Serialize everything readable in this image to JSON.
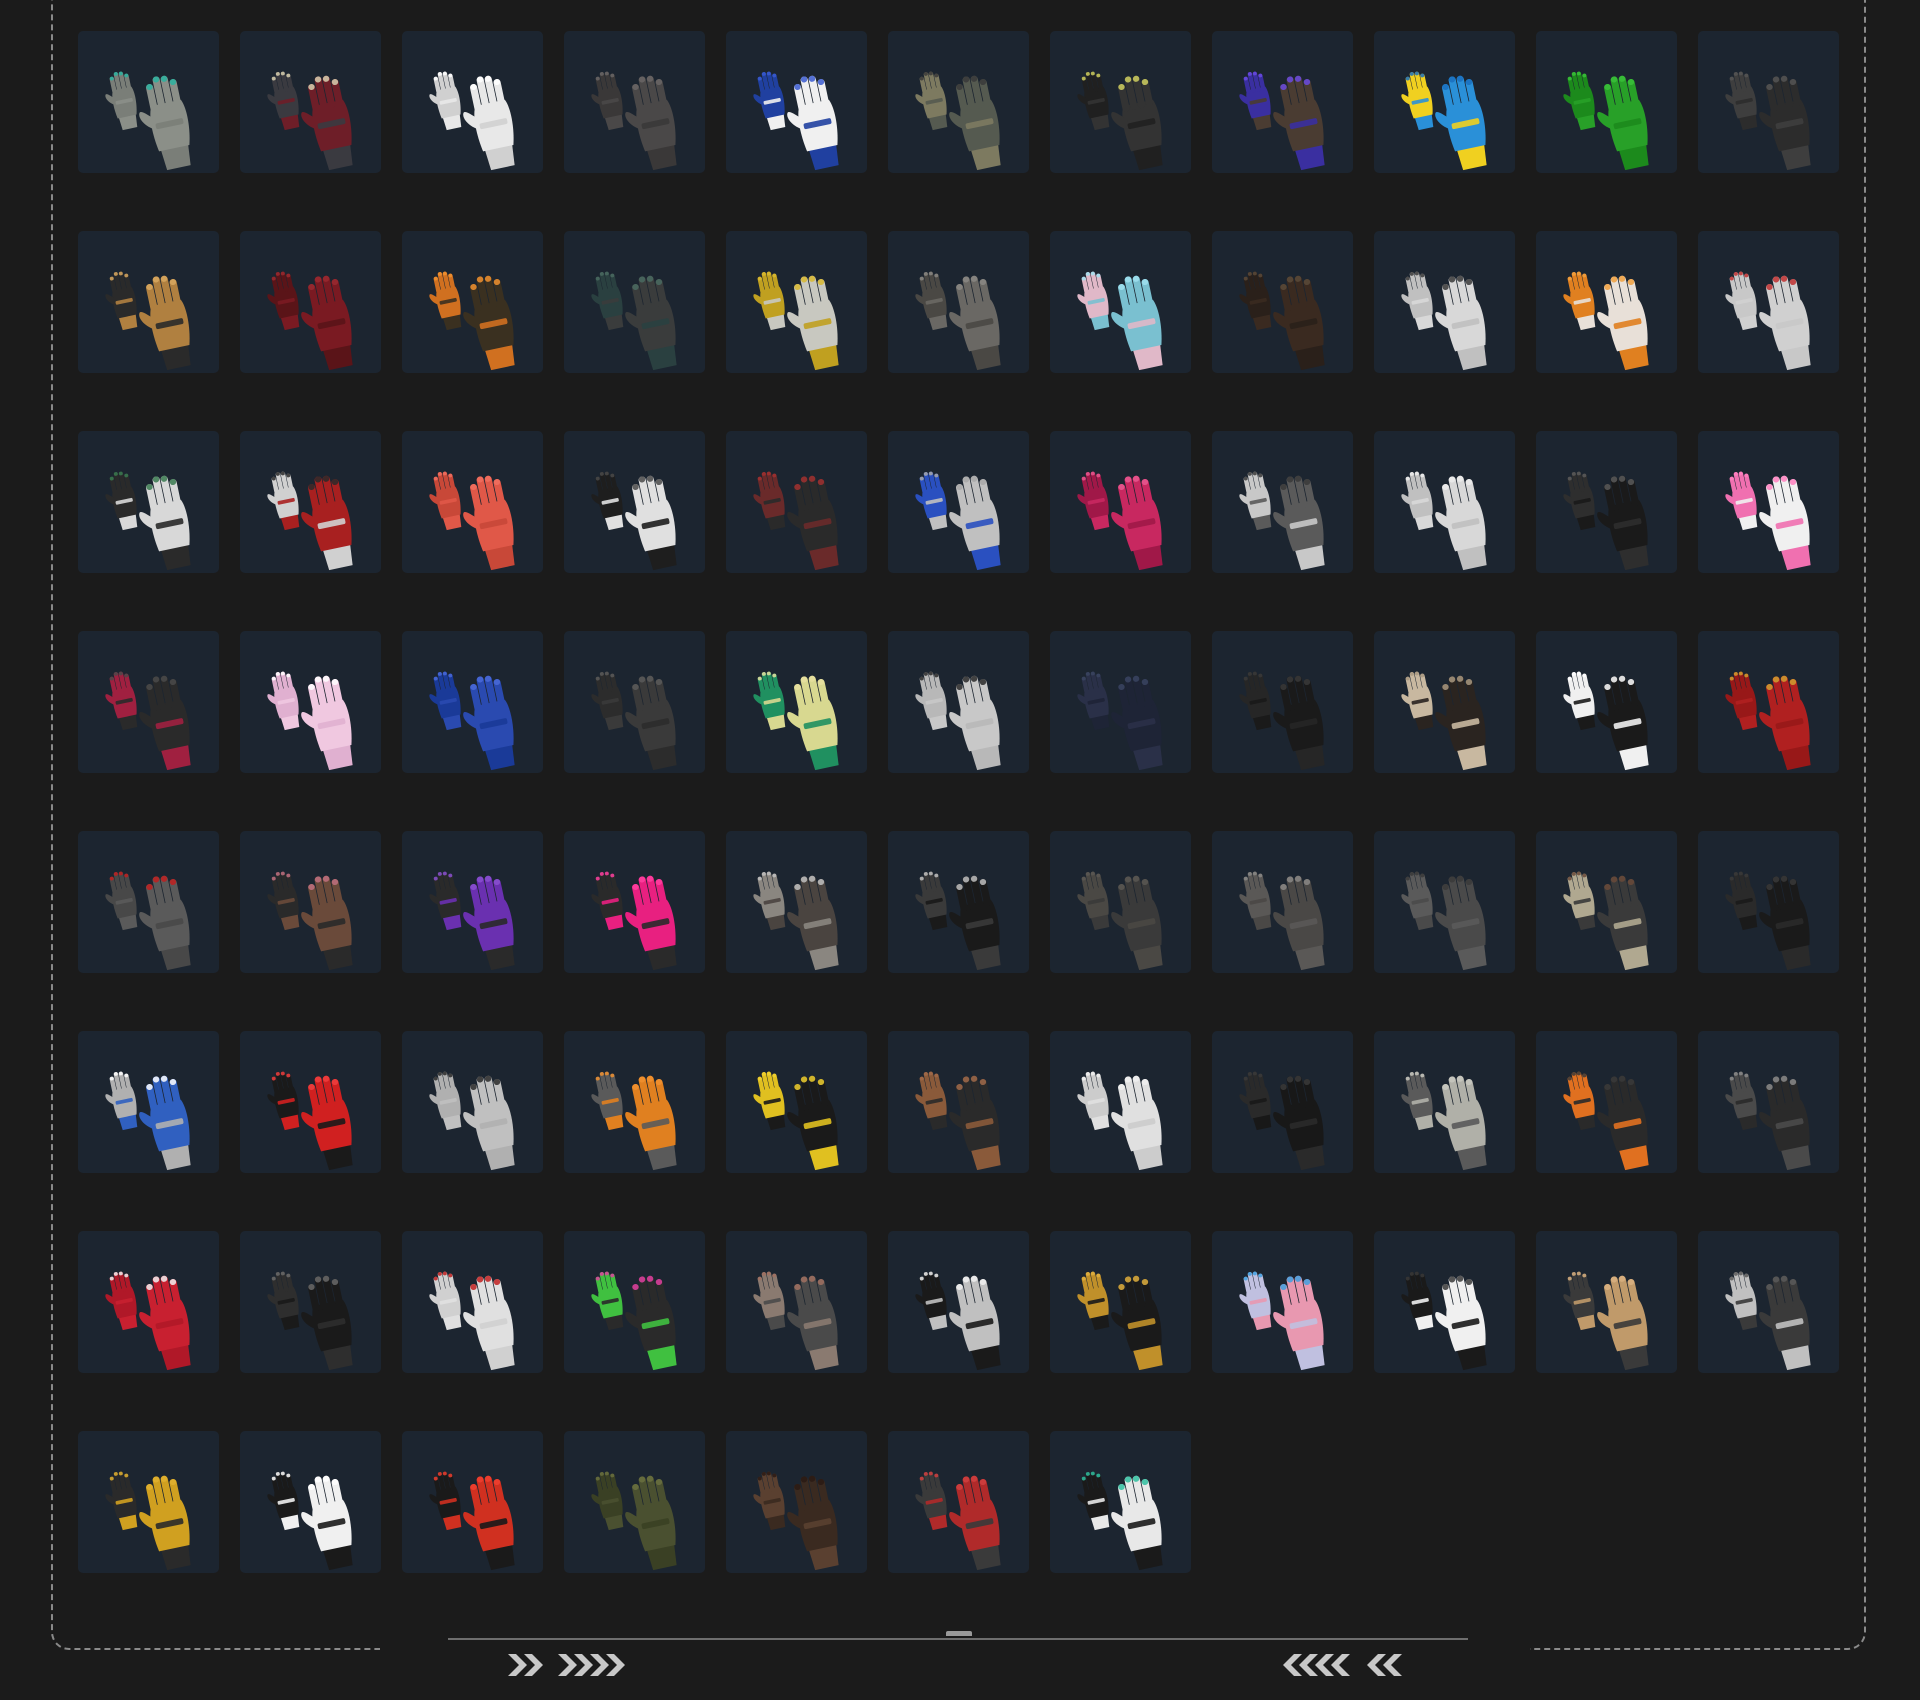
{
  "colors": {
    "background": "#1b1b1b",
    "slot": "#1c2530",
    "frame": "#8a8a8a"
  },
  "footer": {
    "left_chevrons": "forward-chevrons-icon",
    "right_chevrons": "backward-chevrons-icon"
  },
  "inventory": {
    "columns": 11,
    "slots": [
      {
        "icon": "gray-hand-ring-icon",
        "c1": "#8b8f88",
        "c2": "#7a7e78",
        "accent": "#2ab3a0"
      },
      {
        "icon": "red-mech-glove-icon",
        "c1": "#6e1e28",
        "c2": "#3a3a40",
        "accent": "#d8d0b0"
      },
      {
        "icon": "white-fingerless-glove-icon",
        "c1": "#e8e8e8",
        "c2": "#d0d0d0",
        "accent": "#ffffff"
      },
      {
        "icon": "dark-leather-fingerless-icon",
        "c1": "#4a4848",
        "c2": "#3a3838",
        "accent": "#6a6666"
      },
      {
        "icon": "blue-white-glove-icon",
        "c1": "#f0f0f0",
        "c2": "#2040a0",
        "accent": "#3a5ad0"
      },
      {
        "icon": "camo-fingerless-glove-icon",
        "c1": "#555a50",
        "c2": "#7d7a60",
        "accent": "#3a3a3a"
      },
      {
        "icon": "nail-accessories-icon",
        "c1": "#333333",
        "c2": "#202020",
        "accent": "#cfcf60"
      },
      {
        "icon": "purple-claw-glove-icon",
        "c1": "#4a3c32",
        "c2": "#3a2fa0",
        "accent": "#6a4ae0"
      },
      {
        "icon": "blue-yellow-glove-icon",
        "c1": "#2a90d8",
        "c2": "#f0d020",
        "accent": "#1a70c0"
      },
      {
        "icon": "green-glove-icon",
        "c1": "#28a028",
        "c2": "#1c8a1c",
        "accent": "#3ac03a"
      },
      {
        "icon": "black-leather-glove-icon",
        "c1": "#2c2c2c",
        "c2": "#3e3e3e",
        "accent": "#555555"
      },
      {
        "icon": "gold-armor-glove-icon",
        "c1": "#b08040",
        "c2": "#2a2a2a",
        "accent": "#d8a860"
      },
      {
        "icon": "maroon-glove-icon",
        "c1": "#7a1a22",
        "c2": "#5a1418",
        "accent": "#9a2a30"
      },
      {
        "icon": "orange-tactical-glove-icon",
        "c1": "#3a3020",
        "c2": "#d07020",
        "accent": "#f09030"
      },
      {
        "icon": "dark-teal-fingerless-icon",
        "c1": "#3a3c3c",
        "c2": "#2a4040",
        "accent": "#4a6a60"
      },
      {
        "icon": "yellow-gray-work-glove-icon",
        "c1": "#c8c8c0",
        "c2": "#c0a020",
        "accent": "#d8b830"
      },
      {
        "icon": "gray-wrapped-glove-icon",
        "c1": "#6a6864",
        "c2": "#4a4844",
        "accent": "#8a8884"
      },
      {
        "icon": "cyan-spiked-glove-icon",
        "c1": "#7ac0d0",
        "c2": "#e0b8c8",
        "accent": "#a0e0f0"
      },
      {
        "icon": "brown-knuckle-glove-icon",
        "c1": "#3a2a20",
        "c2": "#2a201a",
        "accent": "#5a4a3a"
      },
      {
        "icon": "white-knuckle-glove-icon",
        "c1": "#d8d8d8",
        "c2": "#c0c0c0",
        "accent": "#3a3a3a"
      },
      {
        "icon": "orange-white-glove-icon",
        "c1": "#e8e0d8",
        "c2": "#e08020",
        "accent": "#f0a040"
      },
      {
        "icon": "white-hand-red-nails-icon",
        "c1": "#d0d0d0",
        "c2": "#c8c8c8",
        "accent": "#c03030"
      },
      {
        "icon": "white-black-tactical-glove-icon",
        "c1": "#d8d8d8",
        "c2": "#2a2a2a",
        "accent": "#3a7a50"
      },
      {
        "icon": "red-moto-glove-icon",
        "c1": "#a82020",
        "c2": "#d0d0d0",
        "accent": "#2a2a2a"
      },
      {
        "icon": "coral-glove-icon",
        "c1": "#e05848",
        "c2": "#c84838",
        "accent": "#f07060"
      },
      {
        "icon": "black-white-moto-glove-icon",
        "c1": "#e0e0e0",
        "c2": "#1e1e1e",
        "accent": "#4a4a4a"
      },
      {
        "icon": "black-red-stitched-glove-icon",
        "c1": "#2a2a2a",
        "c2": "#6a2a2a",
        "accent": "#a03030"
      },
      {
        "icon": "gray-blue-knit-glove-icon",
        "c1": "#c0c0c0",
        "c2": "#2a50c0",
        "accent": "#a8a8a8"
      },
      {
        "icon": "pink-fingerless-glove-icon",
        "c1": "#c82860",
        "c2": "#a01848",
        "accent": "#e85890"
      },
      {
        "icon": "gray-armored-glove-icon",
        "c1": "#5a5a5a",
        "c2": "#c8c8c8",
        "accent": "#3a3a3a"
      },
      {
        "icon": "white-hand-icon",
        "c1": "#d8d8d8",
        "c2": "#c0c0c0",
        "accent": "#ececec"
      },
      {
        "icon": "black-buckle-glove-icon",
        "c1": "#1a1a1a",
        "c2": "#2e2e2e",
        "accent": "#5a5a5a"
      },
      {
        "icon": "white-pink-glove-icon",
        "c1": "#f0f0f0",
        "c2": "#f070b0",
        "accent": "#ff80c0"
      },
      {
        "icon": "black-red-tactical-glove-icon",
        "c1": "#2a2a2a",
        "c2": "#a02040",
        "accent": "#4a4a4a"
      },
      {
        "icon": "light-pink-glove-icon",
        "c1": "#f0c8e0",
        "c2": "#e0b0d0",
        "accent": "#ffffff"
      },
      {
        "icon": "blue-glove-icon",
        "c1": "#2a4ab0",
        "c2": "#1a3a98",
        "accent": "#4a6ad8"
      },
      {
        "icon": "dark-gray-glove-icon",
        "c1": "#3a3a3a",
        "c2": "#2c2c2c",
        "accent": "#5a5a5a"
      },
      {
        "icon": "yellow-green-knit-glove-icon",
        "c1": "#d8d890",
        "c2": "#209060",
        "accent": "#e8e0a0"
      },
      {
        "icon": "white-hand-bracelet-icon",
        "c1": "#c8c8c8",
        "c2": "#b8b8b8",
        "accent": "#2a2a2a"
      },
      {
        "icon": "navy-glove-icon",
        "c1": "#1e2436",
        "c2": "#2a3048",
        "accent": "#3a4460"
      },
      {
        "icon": "black-long-glove-icon",
        "c1": "#1a1a1a",
        "c2": "#262626",
        "accent": "#3a3a3a"
      },
      {
        "icon": "skeleton-glove-icon",
        "c1": "#2a2420",
        "c2": "#c8b8a0",
        "accent": "#a89880"
      },
      {
        "icon": "black-white-sport-glove-icon",
        "c1": "#1a1a1a",
        "c2": "#f0f0f0",
        "accent": "#ffffff"
      },
      {
        "icon": "red-gold-glove-icon",
        "c1": "#b02020",
        "c2": "#981818",
        "accent": "#d0a030"
      },
      {
        "icon": "gray-wrist-guard-icon",
        "c1": "#5a5a5a",
        "c2": "#484848",
        "accent": "#c02020"
      },
      {
        "icon": "brown-arm-sleeve-icon",
        "c1": "#6a4a3a",
        "c2": "#2a2a2a",
        "accent": "#c07080"
      },
      {
        "icon": "purple-tactical-glove-icon",
        "c1": "#6a30b0",
        "c2": "#2a2a2a",
        "accent": "#8a50d0"
      },
      {
        "icon": "hot-pink-glove-icon",
        "c1": "#e82080",
        "c2": "#2a2a2a",
        "accent": "#ff40a0"
      },
      {
        "icon": "brown-strap-fingerless-icon",
        "c1": "#4a4440",
        "c2": "#8a8680",
        "accent": "#c0c0c0"
      },
      {
        "icon": "black-strap-glove-icon",
        "c1": "#1a1a1a",
        "c2": "#3a3a3a",
        "accent": "#c0c0c0"
      },
      {
        "icon": "dark-wrap-bandage-icon",
        "c1": "#3a3a3a",
        "c2": "#4a4844",
        "accent": "#5a5854"
      },
      {
        "icon": "gray-stud-bracer-icon",
        "c1": "#4a4846",
        "c2": "#5a5856",
        "accent": "#8a8886"
      },
      {
        "icon": "dark-gray-wrap-glove-icon",
        "c1": "#4a4a4a",
        "c2": "#5a5a5a",
        "accent": "#3a3a3a"
      },
      {
        "icon": "silver-knuckle-glove-icon",
        "c1": "#3a3a3a",
        "c2": "#b0a890",
        "accent": "#6a4a3a"
      },
      {
        "icon": "black-sleeve-icon",
        "c1": "#1a1a1a",
        "c2": "#2a2a2a",
        "accent": "#3a3a3a"
      },
      {
        "icon": "blue-chainmail-glove-icon",
        "c1": "#3060c0",
        "c2": "#b0b0b0",
        "accent": "#ffffff"
      },
      {
        "icon": "red-black-glove-icon",
        "c1": "#d02020",
        "c2": "#1a1a1a",
        "accent": "#f04040"
      },
      {
        "icon": "gray-hand-rings-icon",
        "c1": "#c0c0c0",
        "c2": "#b0b0b0",
        "accent": "#2a2a2a"
      },
      {
        "icon": "orange-gray-glove-icon",
        "c1": "#e08020",
        "c2": "#5a5a5a",
        "accent": "#f09030"
      },
      {
        "icon": "yellow-black-moto-glove-icon",
        "c1": "#1a1a1a",
        "c2": "#e0c020",
        "accent": "#f0d030"
      },
      {
        "icon": "claw-accessories-icon",
        "c1": "#2a2a2a",
        "c2": "#8a5a3a",
        "accent": "#a06a4a"
      },
      {
        "icon": "white-cloth-glove-icon",
        "c1": "#e0e0e0",
        "c2": "#cccccc",
        "accent": "#f0f0f0"
      },
      {
        "icon": "black-leather-tight-glove-icon",
        "c1": "#181818",
        "c2": "#2a2a2a",
        "accent": "#3a3a3a"
      },
      {
        "icon": "bandage-wrap-glove-icon",
        "c1": "#b0b0a8",
        "c2": "#5a5a5a",
        "accent": "#c8c8c0"
      },
      {
        "icon": "black-orange-tactical-glove-icon",
        "c1": "#2a2a2a",
        "c2": "#e07020",
        "accent": "#3a3a3a"
      },
      {
        "icon": "black-fingerless-spike-glove-icon",
        "c1": "#2a2a2a",
        "c2": "#4a4a4a",
        "accent": "#8a8a8a"
      },
      {
        "icon": "red-snowflake-glove-icon",
        "c1": "#c82030",
        "c2": "#b01828",
        "accent": "#f0f0f0"
      },
      {
        "icon": "black-studded-glove-icon",
        "c1": "#1a1a1a",
        "c2": "#2e2e2e",
        "accent": "#6a6a6a"
      },
      {
        "icon": "white-hand-red-tips-icon",
        "c1": "#e0e0e0",
        "c2": "#d0d0d0",
        "accent": "#c02020"
      },
      {
        "icon": "colorful-nail-set-icon",
        "c1": "#2a2a2a",
        "c2": "#40c040",
        "accent": "#e040a0"
      },
      {
        "icon": "gray-brown-glove-icon",
        "c1": "#4a4a4a",
        "c2": "#8a7a70",
        "accent": "#a07060"
      },
      {
        "icon": "white-skeleton-glove-icon",
        "c1": "#c0c0c0",
        "c2": "#1a1a1a",
        "accent": "#f0f0f0"
      },
      {
        "icon": "gold-claw-glove-icon",
        "c1": "#1a1a1a",
        "c2": "#c0902a",
        "accent": "#e0b040"
      },
      {
        "icon": "pink-fluffy-glove-icon",
        "c1": "#e898b0",
        "c2": "#c0c0e0",
        "accent": "#40a0e0"
      },
      {
        "icon": "white-black-sport-glove-icon",
        "c1": "#f0f0f0",
        "c2": "#1a1a1a",
        "accent": "#3a3a3a"
      },
      {
        "icon": "tan-tactical-glove-icon",
        "c1": "#c09a6a",
        "c2": "#3a3a3a",
        "accent": "#d8b080"
      },
      {
        "icon": "silver-fingerless-mesh-icon",
        "c1": "#3a3a3a",
        "c2": "#c0c0c0",
        "accent": "#5a5a5a"
      },
      {
        "icon": "yellow-fingerless-glove-icon",
        "c1": "#d0a020",
        "c2": "#2a2a2a",
        "accent": "#e0b030"
      },
      {
        "icon": "panda-glove-icon",
        "c1": "#f0f0f0",
        "c2": "#1a1a1a",
        "accent": "#ffffff"
      },
      {
        "icon": "red-black-armored-glove-icon",
        "c1": "#d03020",
        "c2": "#1a1a1a",
        "accent": "#f04030"
      },
      {
        "icon": "olive-leather-glove-icon",
        "c1": "#4a5030",
        "c2": "#3a4024",
        "accent": "#6a7040"
      },
      {
        "icon": "brown-fur-fingerless-icon",
        "c1": "#3a2a20",
        "c2": "#5a4030",
        "accent": "#2a1a14"
      },
      {
        "icon": "red-gray-moto-glove-icon",
        "c1": "#b02a2a",
        "c2": "#3a3a3a",
        "accent": "#d04040"
      },
      {
        "icon": "white-teal-tactical-glove-icon",
        "c1": "#e8e8e8",
        "c2": "#1a1a1a",
        "accent": "#30c0a0"
      }
    ]
  }
}
